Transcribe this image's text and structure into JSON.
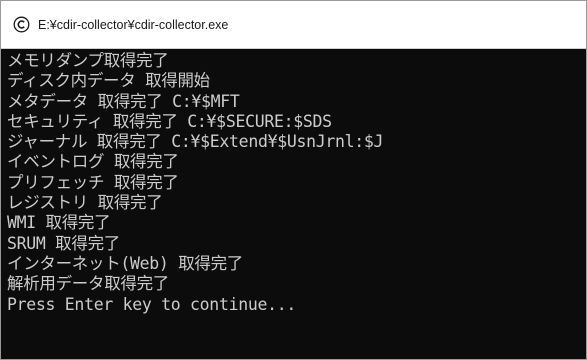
{
  "window": {
    "title": "E:¥cdir-collector¥cdir-collector.exe",
    "icon": "cdir-collector-app-icon",
    "colors": {
      "console_background": "#0c0c0c",
      "console_text": "#cccccc",
      "titlebar_background": "#ffffff"
    }
  },
  "console": {
    "lines": [
      "メモリダンプ取得完了",
      "ディスク内データ 取得開始",
      "メタデータ 取得完了 C:¥$MFT",
      "セキュリティ 取得完了 C:¥$SECURE:$SDS",
      "ジャーナル 取得完了 C:¥$Extend¥$UsnJrnl:$J",
      "イベントログ 取得完了",
      "プリフェッチ 取得完了",
      "レジストリ 取得完了",
      "WMI 取得完了",
      "SRUM 取得完了",
      "インターネット(Web) 取得完了",
      "解析用データ取得完了",
      "Press Enter key to continue..."
    ]
  }
}
